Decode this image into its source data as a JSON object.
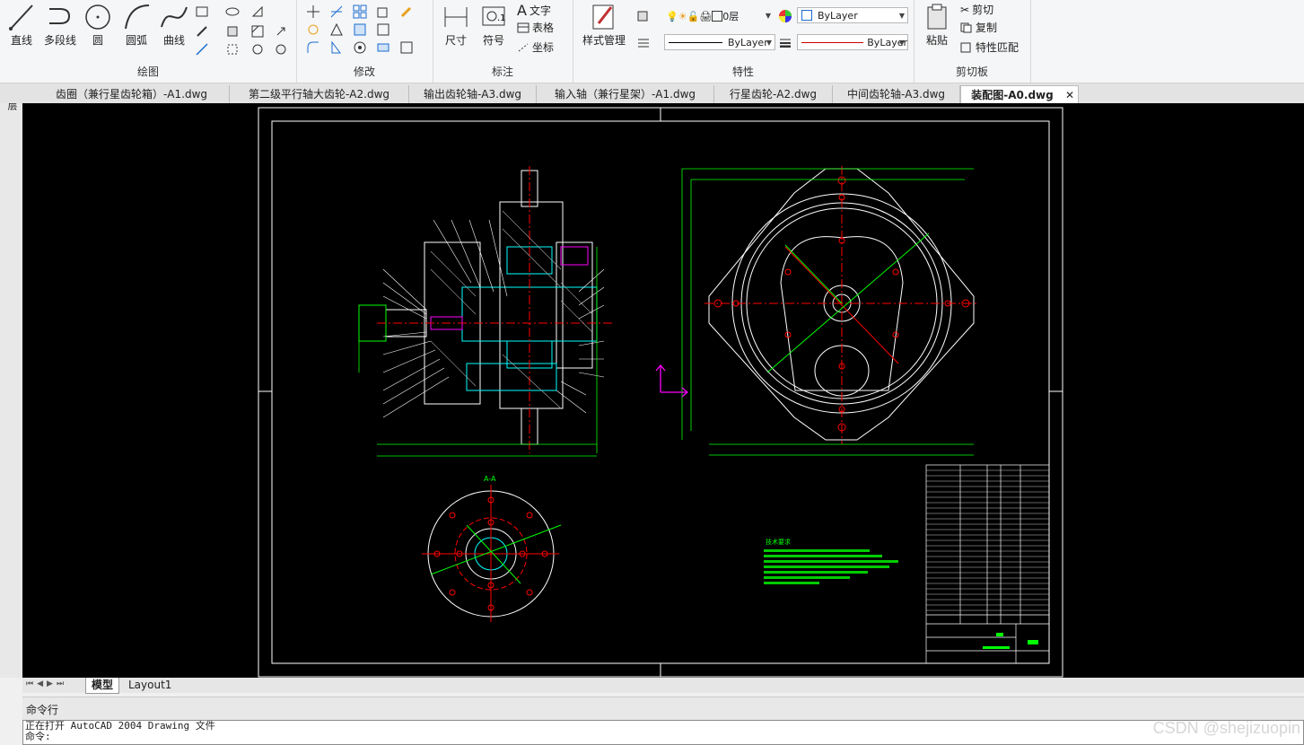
{
  "ribbon": {
    "draw": {
      "title": "绘图",
      "line": "直线",
      "polyline": "多段线",
      "circle": "圆",
      "arc": "圆弧",
      "curve": "曲线"
    },
    "modify": {
      "title": "修改"
    },
    "annotate": {
      "title": "标注",
      "dimension": "尺寸",
      "symbol": "符号",
      "text": "文字",
      "table": "表格",
      "coordinate": "坐标"
    },
    "properties": {
      "title": "特性",
      "style_manager": "样式管理",
      "layer": "0层",
      "color": "ByLayer",
      "linetype": "ByLayer",
      "lineweight": "ByLayer"
    },
    "clipboard": {
      "title": "剪切板",
      "paste": "粘贴",
      "cut": "剪切",
      "copy": "复制",
      "match": "特性匹配"
    }
  },
  "tabs": [
    "齿圈（兼行星齿轮箱）-A1.dwg",
    "第二级平行轴大齿轮-A2.dwg",
    "输出齿轮轴-A3.dwg",
    "输入轴（兼行星架）-A1.dwg",
    "行星齿轮-A2.dwg",
    "中间齿轮轴-A3.dwg",
    "装配图-A0.dwg"
  ],
  "left_panel_label": "图层",
  "drawing": {
    "section_label": "A-A",
    "notes_title": "技术要求"
  },
  "layout_tabs": {
    "model": "模型",
    "layout1": "Layout1"
  },
  "command": {
    "title": "命令行",
    "line1": "正在打开 AutoCAD 2004 Drawing 文件",
    "line2": "命令:"
  },
  "watermark": "CSDN @shejizuopin",
  "colors": {
    "canvas": "#000000",
    "green": "#00ff00",
    "cyan": "#00ffff",
    "red": "#ff0000",
    "magenta": "#ff00ff",
    "white": "#ffffff"
  }
}
